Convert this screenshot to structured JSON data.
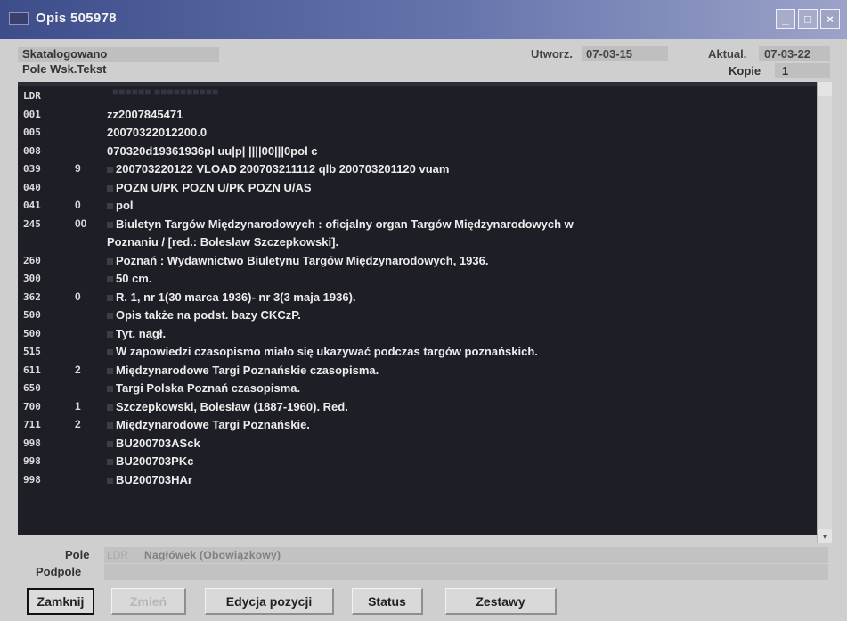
{
  "window": {
    "title": "Opis  505978"
  },
  "header": {
    "status": "Skatalogowano",
    "columns_label": "Pole   Wsk.Tekst",
    "created_label": "Utworz.",
    "created_value": "07-03-15",
    "updated_label": "Aktual.",
    "updated_value": "07-03-22",
    "copies_label": "Kopie",
    "copies_value": "1"
  },
  "record": {
    "rows": [
      {
        "tag": "LDR",
        "ind": "",
        "text": ""
      },
      {
        "tag": "001",
        "ind": "",
        "text": "zz2007845471"
      },
      {
        "tag": "005",
        "ind": "",
        "text": "20070322012200.0"
      },
      {
        "tag": "008",
        "ind": "",
        "text": "070320d19361936pl uu|p|  ||||00|||0pol c"
      },
      {
        "tag": "039",
        "ind": "9",
        "text": "200703220122    VLOAD    200703211112    qlb    200703201120    vuam"
      },
      {
        "tag": "040",
        "ind": "",
        "text": "POZN U/PK    POZN U/PK    POZN U/AS"
      },
      {
        "tag": "041",
        "ind": "0",
        "text": "pol"
      },
      {
        "tag": "245",
        "ind": "00",
        "text": "Biuletyn Targów Międzynarodowych :    oficjalny organ Targów Międzynarodowych w"
      },
      {
        "tag": "",
        "ind": "",
        "text": "Poznaniu /    [red.: Bolesław Szczepkowski]."
      },
      {
        "tag": "260",
        "ind": "",
        "text": "Poznań :    Wydawnictwo Biuletynu Targów Międzynarodowych,    1936."
      },
      {
        "tag": "300",
        "ind": "",
        "text": "50 cm."
      },
      {
        "tag": "362",
        "ind": "0",
        "text": "R. 1, nr 1(30 marca 1936)- nr 3(3 maja 1936)."
      },
      {
        "tag": "500",
        "ind": "",
        "text": "Opis także na podst. bazy CKCzP."
      },
      {
        "tag": "500",
        "ind": "",
        "text": "Tyt. nagł."
      },
      {
        "tag": "515",
        "ind": "",
        "text": "W zapowiedzi czasopismo miało się ukazywać podczas targów poznańskich."
      },
      {
        "tag": "611",
        "ind": "2",
        "text": "Międzynarodowe Targi Poznańskie    czasopisma."
      },
      {
        "tag": "650",
        "ind": "",
        "text": "Targi    Polska    Poznań    czasopisma."
      },
      {
        "tag": "700",
        "ind": "1",
        "text": "Szczepkowski, Bolesław    (1887-1960).    Red."
      },
      {
        "tag": "711",
        "ind": "2",
        "text": "Międzynarodowe Targi Poznańskie."
      },
      {
        "tag": "998",
        "ind": "",
        "text": "BU200703ASck"
      },
      {
        "tag": "998",
        "ind": "",
        "text": "BU200703PKc"
      },
      {
        "tag": "998",
        "ind": "",
        "text": "BU200703HAr"
      }
    ]
  },
  "footer": {
    "pole_label": "Pole",
    "pole_code": "LDR",
    "pole_desc": "Nagłówek (Obowiązkowy)",
    "podpole_label": "Podpole"
  },
  "buttons": {
    "close": "Zamknij",
    "disabled": "Zmień",
    "edit": "Edycja pozycji",
    "status": "Status",
    "sets": "Zestawy"
  },
  "colors": {
    "titlebar": "#3d4d8a",
    "record_bg": "#1e1e26",
    "window_bg": "#cfcfcf"
  }
}
